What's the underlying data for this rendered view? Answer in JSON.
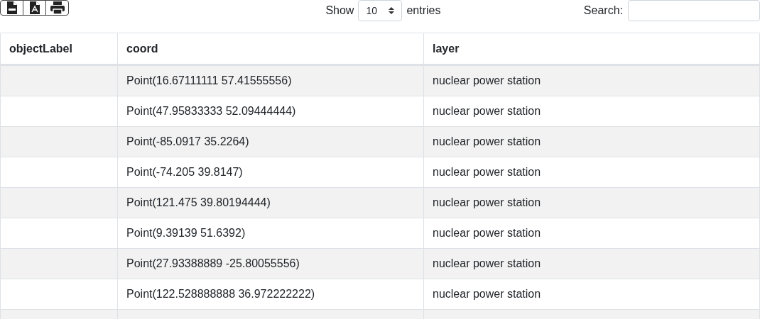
{
  "toolbar": {
    "length": {
      "label_before": "Show",
      "value": "10",
      "label_after": "entries"
    },
    "search": {
      "label": "Search:"
    }
  },
  "table": {
    "columns": [
      "objectLabel",
      "coord",
      "layer"
    ],
    "rows": [
      {
        "coord": "Point(16.67111111 57.41555556)",
        "layer": "nuclear power station"
      },
      {
        "coord": "Point(47.95833333 52.09444444)",
        "layer": "nuclear power station"
      },
      {
        "coord": "Point(-85.0917 35.2264)",
        "layer": "nuclear power station"
      },
      {
        "coord": "Point(-74.205 39.8147)",
        "layer": "nuclear power station"
      },
      {
        "coord": "Point(121.475 39.80194444)",
        "layer": "nuclear power station"
      },
      {
        "coord": "Point(9.39139 51.6392)",
        "layer": "nuclear power station"
      },
      {
        "coord": "Point(27.93388889 -25.80055556)",
        "layer": "nuclear power station"
      },
      {
        "coord": "Point(122.528888888 36.972222222)",
        "layer": "nuclear power station"
      }
    ]
  }
}
